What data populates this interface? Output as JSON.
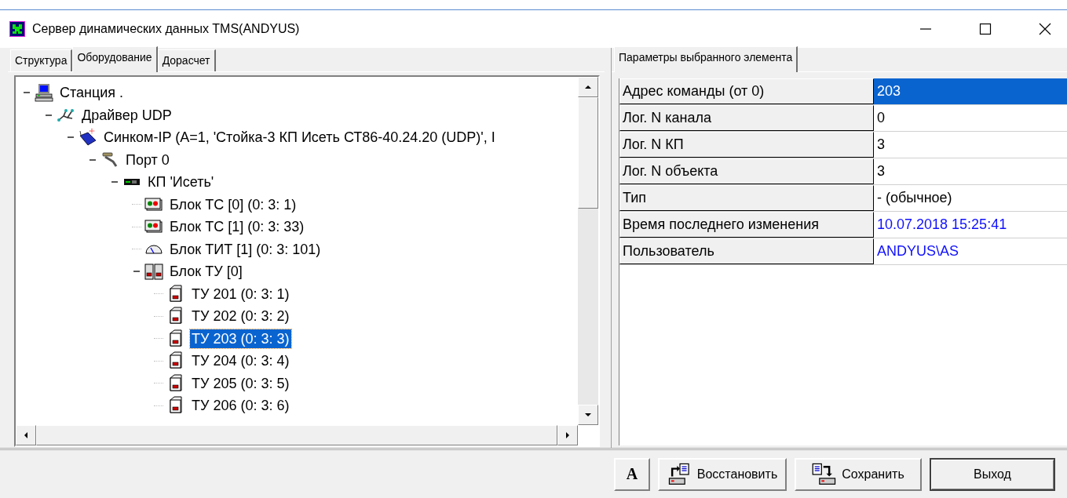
{
  "window": {
    "title": "Сервер динамических данных TMS(ANDYUS)"
  },
  "left_tabs": [
    {
      "label": "Структура",
      "selected": false
    },
    {
      "label": "Оборудование",
      "selected": true
    },
    {
      "label": "Дорасчет",
      "selected": false
    }
  ],
  "tree": [
    {
      "label": "Станция  .",
      "kind": "computer",
      "expanded": true,
      "selected": false,
      "children": [
        {
          "label": "Драйвер UDP",
          "kind": "network",
          "expanded": true,
          "selected": false,
          "children": [
            {
              "label": "Синком-IP  (A=1, 'Стойка-3 КП Исеть СТ86-40.24.20 (UDP)', I",
              "kind": "modem",
              "expanded": true,
              "selected": false,
              "children": [
                {
                  "label": "Порт 0",
                  "kind": "plug",
                  "expanded": true,
                  "selected": false,
                  "children": [
                    {
                      "label": "КП 'Исеть'",
                      "kind": "rack",
                      "expanded": true,
                      "selected": false,
                      "children": [
                        {
                          "label": "Блок ТС  [0] (0: 3: 1)",
                          "kind": "signal-block",
                          "selected": false
                        },
                        {
                          "label": "Блок ТС  [1] (0: 3: 33)",
                          "kind": "signal-block",
                          "selected": false
                        },
                        {
                          "label": "Блок ТИТ  [1] (0: 3: 101)",
                          "kind": "gauge",
                          "selected": false
                        },
                        {
                          "label": "Блок ТУ  [0]",
                          "kind": "control-block",
                          "expanded": true,
                          "selected": false,
                          "children": [
                            {
                              "label": "ТУ  201 (0: 3: 1)",
                              "kind": "control",
                              "selected": false
                            },
                            {
                              "label": "ТУ  202 (0: 3: 2)",
                              "kind": "control",
                              "selected": false
                            },
                            {
                              "label": "ТУ  203 (0: 3: 3)",
                              "kind": "control",
                              "selected": true
                            },
                            {
                              "label": "ТУ  204 (0: 3: 4)",
                              "kind": "control",
                              "selected": false
                            },
                            {
                              "label": "ТУ  205 (0: 3: 5)",
                              "kind": "control",
                              "selected": false
                            },
                            {
                              "label": "ТУ  206 (0: 3: 6)",
                              "kind": "control",
                              "selected": false
                            }
                          ]
                        }
                      ]
                    }
                  ]
                }
              ]
            }
          ]
        }
      ]
    }
  ],
  "right_tabs": [
    {
      "label": "Параметры выбранного элемента",
      "selected": true
    }
  ],
  "properties": [
    {
      "label": "Адрес команды (от 0)",
      "value": "203",
      "selected": true,
      "kind": "plain"
    },
    {
      "label": "Лог. N канала",
      "value": "0",
      "selected": false,
      "kind": "plain"
    },
    {
      "label": "Лог. N КП",
      "value": "3",
      "selected": false,
      "kind": "plain"
    },
    {
      "label": "Лог. N объекта",
      "value": "3",
      "selected": false,
      "kind": "plain"
    },
    {
      "label": "Тип",
      "value": "-  (обычное)",
      "selected": false,
      "kind": "plain"
    },
    {
      "label": "Время последнего изменения",
      "value": "10.07.2018 15:25:41",
      "selected": false,
      "kind": "info"
    },
    {
      "label": "Пользователь",
      "value": "ANDYUS\\AS",
      "selected": false,
      "kind": "info"
    }
  ],
  "buttons": [
    {
      "label": "A",
      "kind": "font"
    },
    {
      "label": "Восстановить",
      "kind": "restore"
    },
    {
      "label": "Сохранить",
      "kind": "save"
    },
    {
      "label": "Выход",
      "kind": "exit"
    }
  ]
}
